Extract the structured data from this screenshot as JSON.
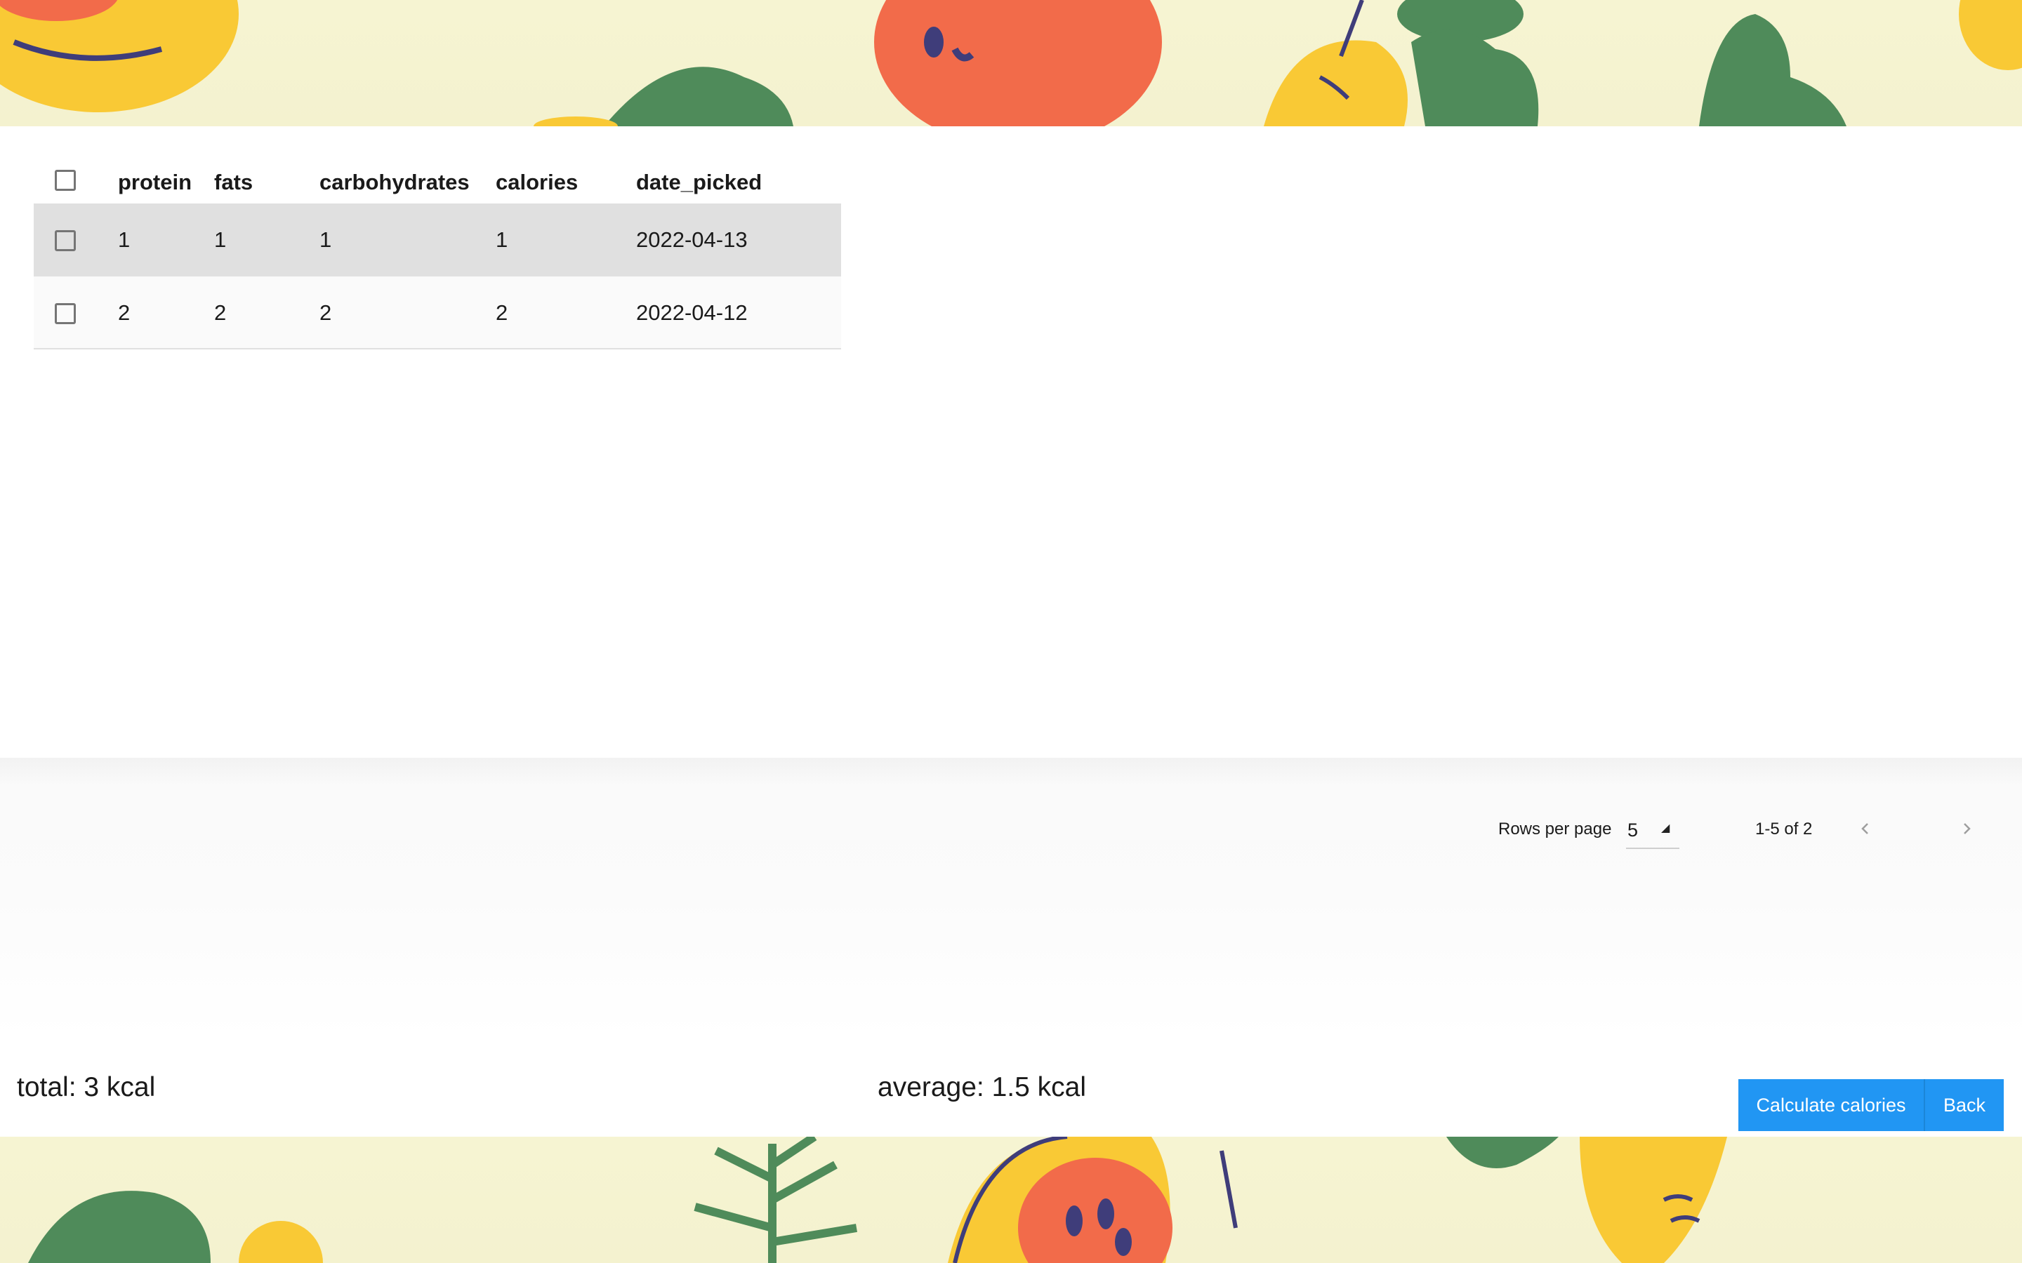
{
  "table": {
    "columns": [
      "protein",
      "fats",
      "carbohydrates",
      "calories",
      "date_picked"
    ],
    "rows": [
      {
        "protein": "1",
        "fats": "1",
        "carbohydrates": "1",
        "calories": "1",
        "date_picked": "2022-04-13",
        "selected": true
      },
      {
        "protein": "2",
        "fats": "2",
        "carbohydrates": "2",
        "calories": "2",
        "date_picked": "2022-04-12",
        "selected": false
      }
    ]
  },
  "pagination": {
    "rows_per_page_label": "Rows per page",
    "rows_per_page_value": "5",
    "range_text": "1-5 of 2"
  },
  "summary": {
    "total": "total: 3 kcal",
    "average": "average: 1.5 kcal"
  },
  "actions": {
    "calculate_label": "Calculate calories",
    "back_label": "Back"
  },
  "colors": {
    "accent": "#2196f3",
    "background": "#f6f4d2",
    "selected_row": "#e0e0e0"
  },
  "icons": {
    "prev": "chevron-left-icon",
    "next": "chevron-right-icon",
    "select": "caret-icon"
  }
}
